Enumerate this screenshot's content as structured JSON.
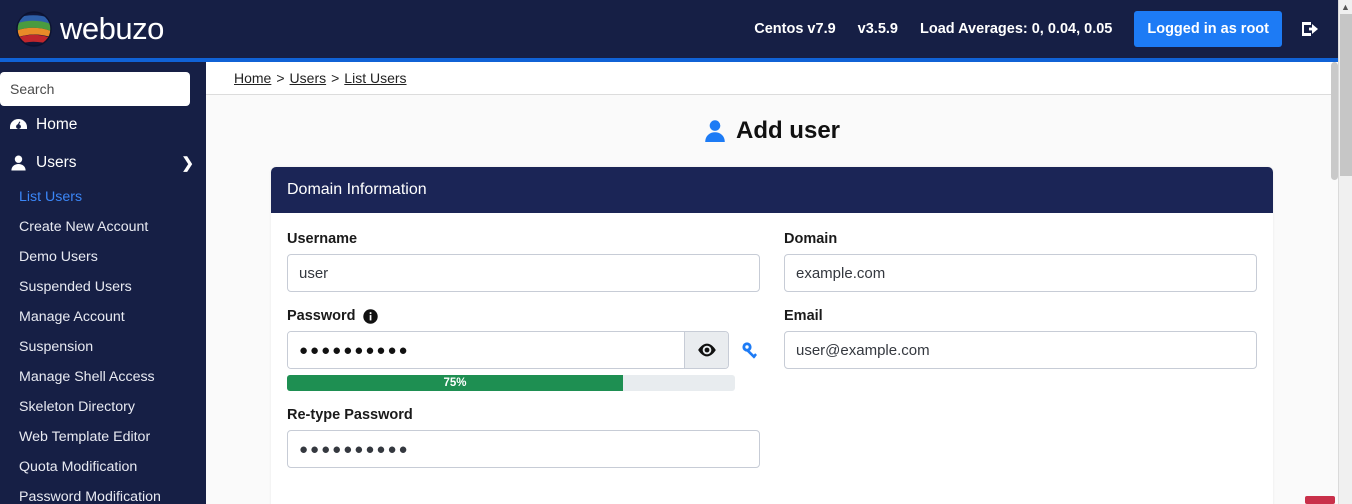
{
  "header": {
    "brand": "webuzo",
    "logo_icon": "webuzo-globe-logo",
    "os_version": "Centos v7.9",
    "app_version": "v3.5.9",
    "load_averages": "Load Averages: 0, 0.04, 0.05",
    "logged_in_label": "Logged in as root",
    "logout_icon": "logout-icon",
    "accent_color": "#1d7bf5",
    "bar_color": "#161f45",
    "rule_color": "#1062d6"
  },
  "sidebar": {
    "search": {
      "placeholder": "Search",
      "value": "",
      "icon": "search-input"
    },
    "top_items": [
      {
        "label": "Home",
        "icon": "dashboard-icon",
        "chevron": ""
      },
      {
        "label": "Users",
        "icon": "user-icon",
        "chevron": "❯"
      }
    ],
    "sub_items": [
      {
        "label": "List Users",
        "active": true
      },
      {
        "label": "Create New Account",
        "active": false
      },
      {
        "label": "Demo Users",
        "active": false
      },
      {
        "label": "Suspended Users",
        "active": false
      },
      {
        "label": "Manage Account",
        "active": false
      },
      {
        "label": "Suspension",
        "active": false
      },
      {
        "label": "Manage Shell Access",
        "active": false
      },
      {
        "label": "Skeleton Directory",
        "active": false
      },
      {
        "label": "Web Template Editor",
        "active": false
      },
      {
        "label": "Quota Modification",
        "active": false
      },
      {
        "label": "Password Modification",
        "active": false
      }
    ],
    "active_color": "#3b86f7"
  },
  "breadcrumb": {
    "items": [
      "Home",
      "Users",
      "List Users"
    ],
    "separator": ">"
  },
  "main": {
    "page_title": "Add user",
    "page_title_icon": "add-user-icon",
    "card": {
      "header": "Domain Information",
      "header_color": "#1b2556",
      "fields": {
        "username": {
          "label": "Username",
          "value": "user"
        },
        "domain": {
          "label": "Domain",
          "value": "example.com"
        },
        "password": {
          "label": "Password",
          "info_icon": "info-icon",
          "value": "●●●●●●●●●●",
          "masked_length": 10,
          "toggle_icon": "eye-icon",
          "generate_icon": "key-icon"
        },
        "email": {
          "label": "Email",
          "value": "user@example.com"
        },
        "retype_password": {
          "label": "Re-type Password",
          "value": "●●●●●●●●●●",
          "masked_length": 10
        }
      },
      "strength_meter": {
        "label": "75%",
        "percent": 75,
        "fill_color": "#1e8f52",
        "track_color": "#e8ecef"
      }
    }
  },
  "scrollbars": {
    "page_arrow_icon": "chevron-up-icon",
    "thumb_color": "#c6c6c6"
  }
}
